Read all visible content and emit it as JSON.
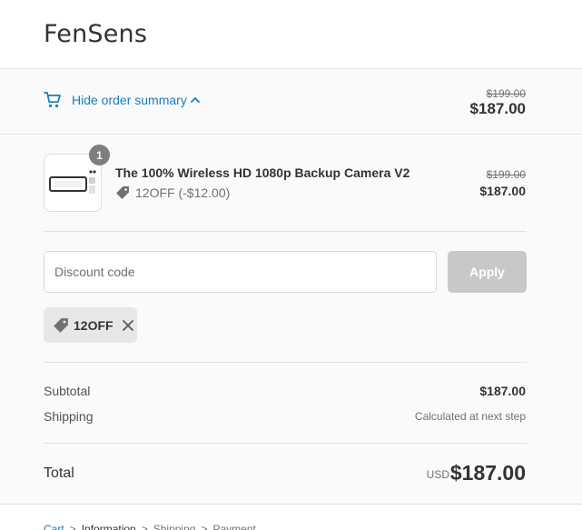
{
  "header": {
    "store_name": "FenSens"
  },
  "summary_toggle": {
    "label": "Hide order summary",
    "original_price": "$199.00",
    "price": "$187.00",
    "icons": {
      "cart": "cart-icon",
      "chevron": "chevron-up-icon"
    }
  },
  "line_item": {
    "quantity": "1",
    "title": "The 100% Wireless HD 1080p Backup Camera V2",
    "discount_label": "12OFF (-$12.00)",
    "original_price": "$199.00",
    "price": "$187.00"
  },
  "discount": {
    "placeholder": "Discount code",
    "value": "",
    "apply_label": "Apply",
    "applied_code": "12OFF"
  },
  "totals": {
    "subtotal_label": "Subtotal",
    "subtotal_value": "$187.00",
    "shipping_label": "Shipping",
    "shipping_value": "Calculated at next step",
    "total_label": "Total",
    "currency": "USD",
    "total_value": "$187.00"
  },
  "breadcrumb": [
    "Cart",
    ">",
    "Information",
    ">",
    "Shipping",
    ">",
    "Payment"
  ],
  "colors": {
    "accent": "#197bbd",
    "button_disabled": "#c8c8c8",
    "badge": "#7e7e7e",
    "summary_bg": "#fafafa",
    "chip_bg": "#e7e7e7"
  }
}
